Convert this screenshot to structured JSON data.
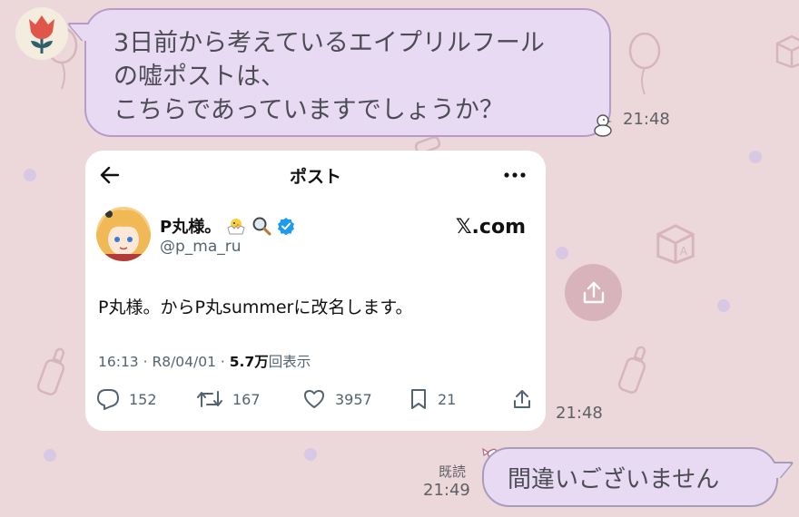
{
  "incoming": {
    "text": "3日前から考えているエイプリルフール\nの嘘ポストは、\nこちらであっていますでしょうか？",
    "time": "21:48",
    "card_time": "21:48"
  },
  "tweet": {
    "header_title": "ポスト",
    "display_name": "P丸様。",
    "username": "@p_ma_ru",
    "source": "𝕏.com",
    "text": "P丸様。からP丸summerに改名します。",
    "meta_time": "16:13 · R8/04/01 · ",
    "views_count": "5.7万",
    "views_label": "回表示",
    "replies": "152",
    "reposts": "167",
    "likes": "3957",
    "bookmarks": "21"
  },
  "outgoing": {
    "text": "間違いございません",
    "read_label": "既読",
    "time": "21:49"
  },
  "colors": {
    "background": "#ecd8db",
    "bubble": "#e9daf3",
    "bubble_border": "#b69cc8",
    "verified": "#1d9bf0"
  },
  "icons": [
    "tulip-icon",
    "back-arrow-icon",
    "more-icon",
    "verified-badge-icon",
    "chick-emoji-icon",
    "magnifier-emoji-icon",
    "reply-icon",
    "repost-icon",
    "like-icon",
    "bookmark-icon",
    "share-icon",
    "share-button-icon"
  ]
}
